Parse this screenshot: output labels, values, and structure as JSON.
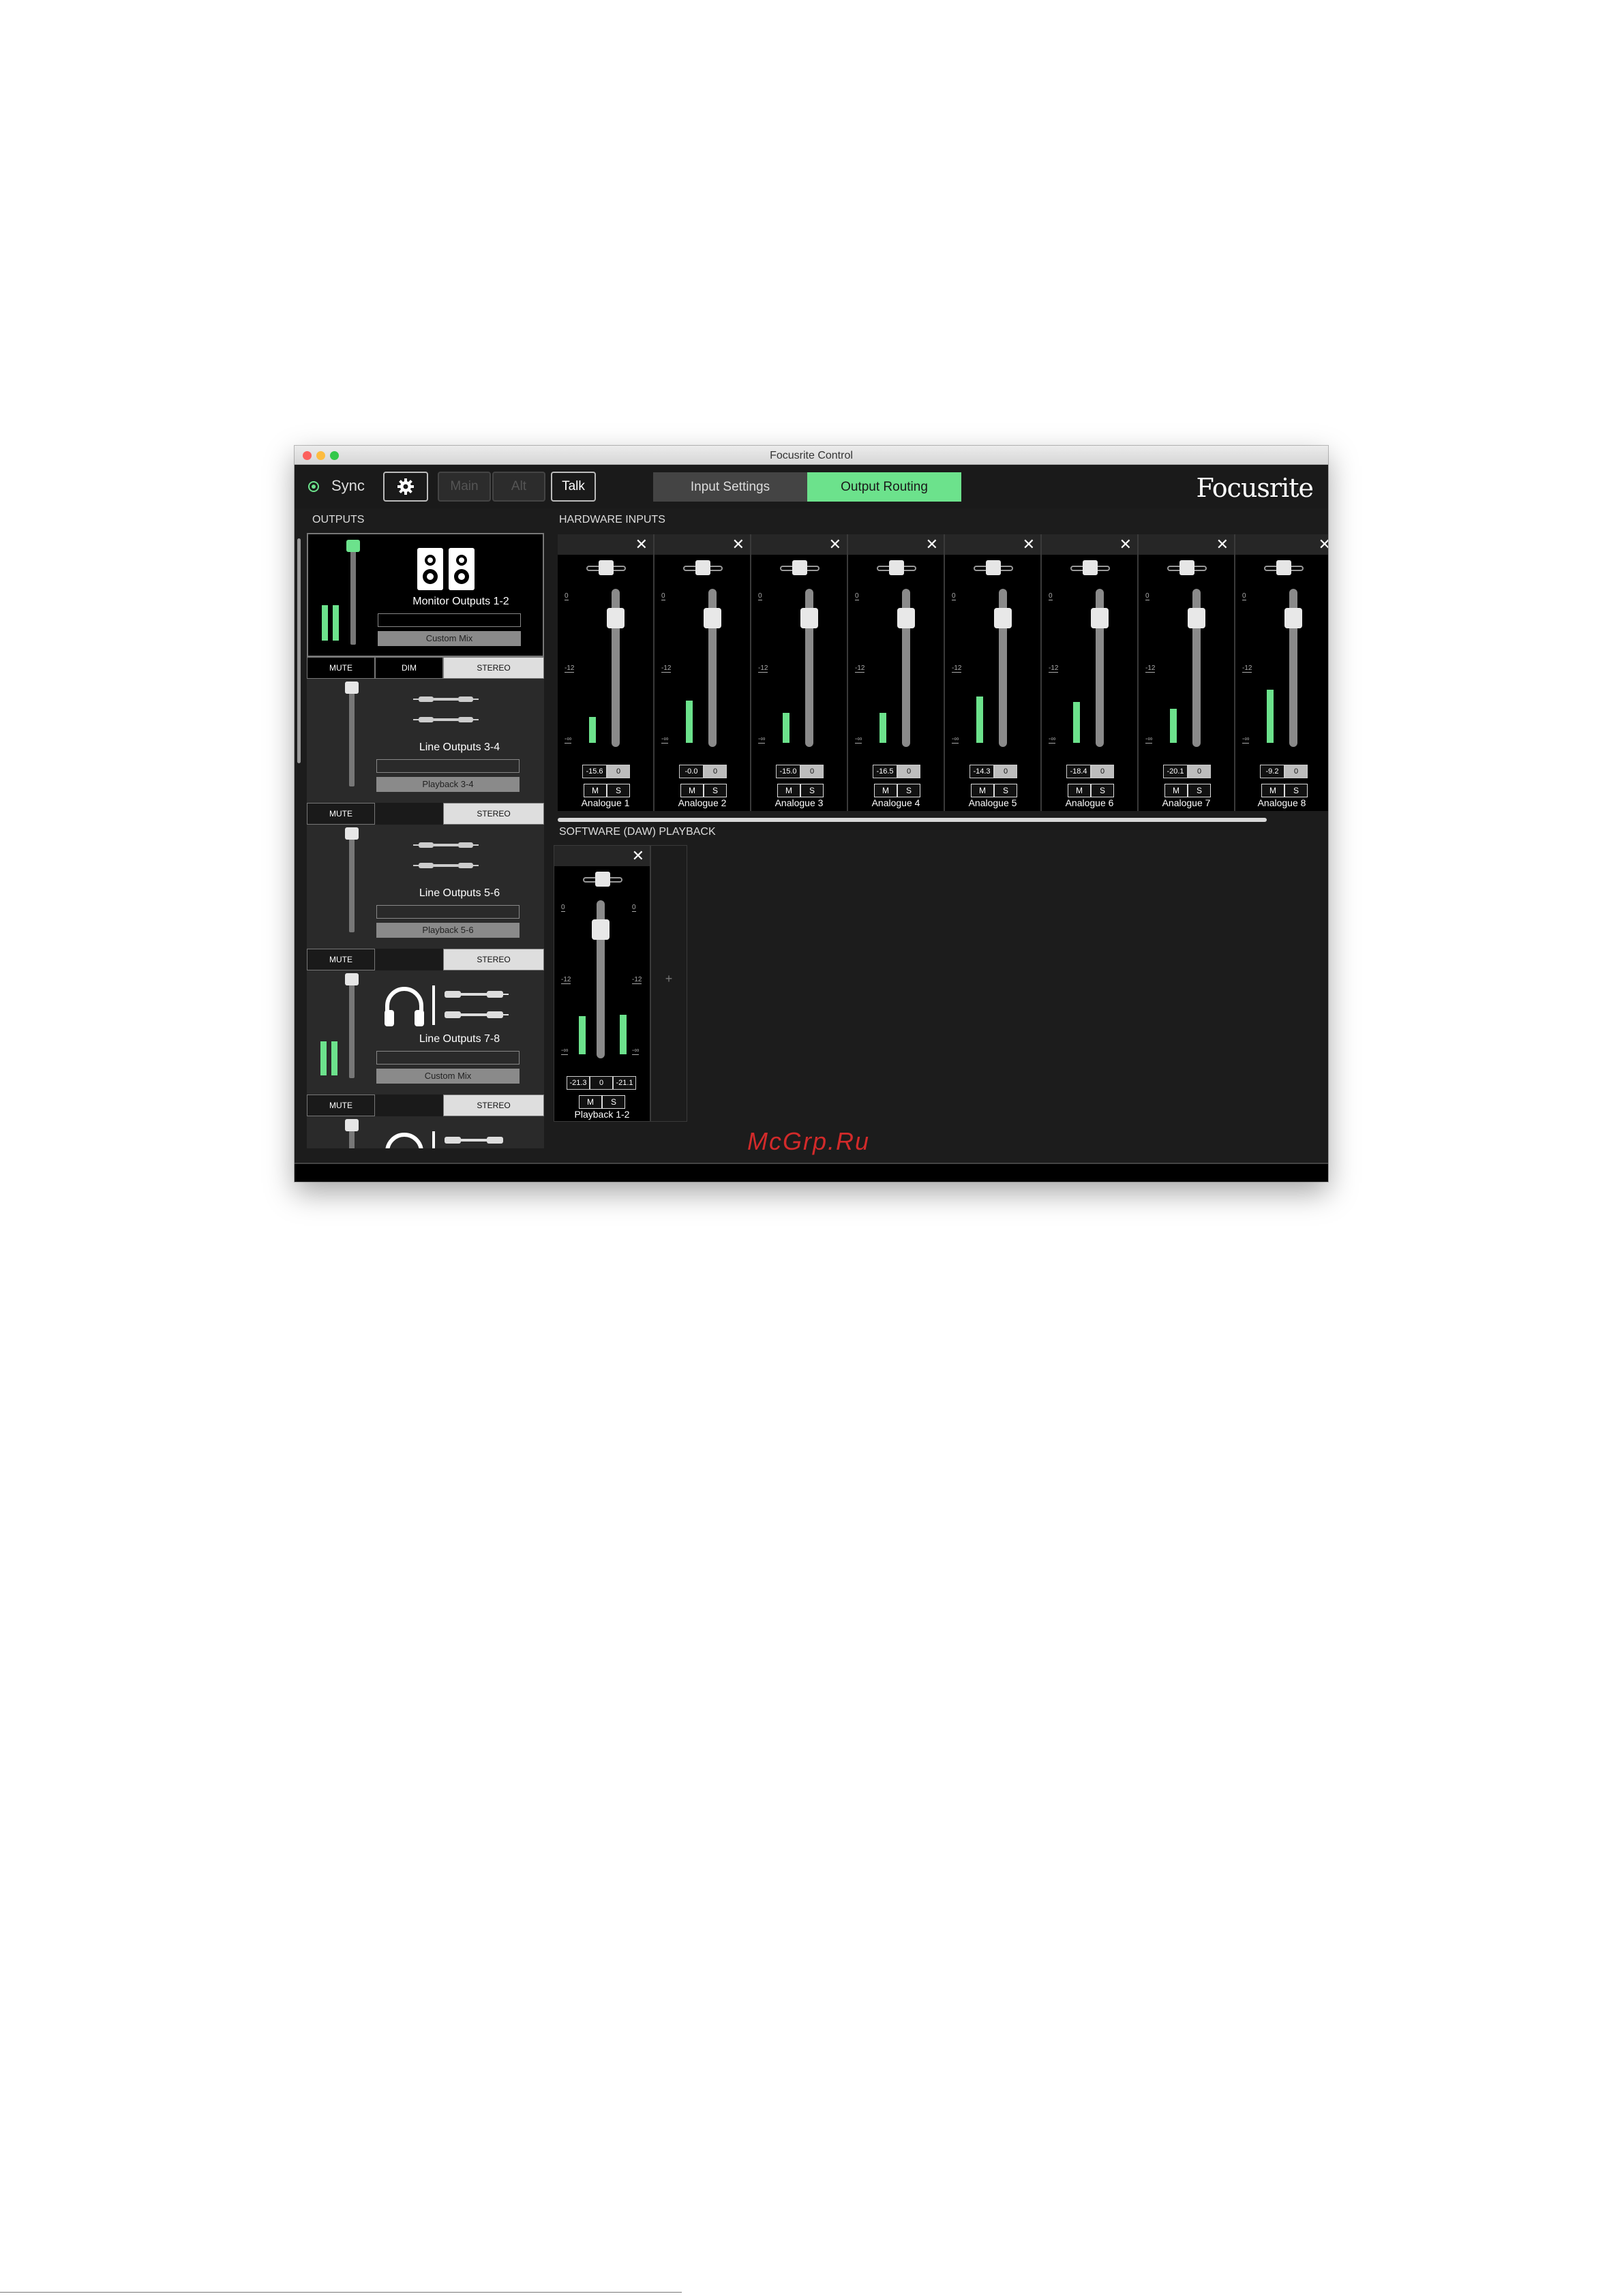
{
  "window": {
    "title": "Focusrite Control"
  },
  "toolbar": {
    "sync_label": "Sync",
    "main_label": "Main",
    "alt_label": "Alt",
    "talk_label": "Talk",
    "tabs": [
      {
        "label": "Input Settings"
      },
      {
        "label": "Output Routing"
      }
    ],
    "brand": "Focusrite"
  },
  "colors": {
    "accent": "#6ce28c",
    "background": "#1c1c1c",
    "watermark": "#d22a2a"
  },
  "outputs": {
    "title": "OUTPUTS",
    "cards": [
      {
        "name": "Monitor Outputs 1-2",
        "source": "Custom Mix",
        "buttons": [
          "MUTE",
          "DIM",
          "STEREO"
        ],
        "icon": "speakers-icon"
      },
      {
        "name": "Line Outputs 3-4",
        "source": "Playback 3-4",
        "buttons": [
          "MUTE",
          "",
          "STEREO"
        ],
        "icon": "jack-cables-icon"
      },
      {
        "name": "Line Outputs 5-6",
        "source": "Playback 5-6",
        "buttons": [
          "MUTE",
          "",
          "STEREO"
        ],
        "icon": "jack-cables-icon"
      },
      {
        "name": "Line Outputs 7-8",
        "source": "Custom Mix",
        "buttons": [
          "MUTE",
          "",
          "STEREO"
        ],
        "icon": "headphones-jack-icon"
      }
    ]
  },
  "hardware_inputs": {
    "title": "HARDWARE INPUTS",
    "scale": [
      "0",
      "-12",
      "-∞"
    ],
    "channels": [
      {
        "name": "Analogue 1",
        "level": "-15.6",
        "pan": "0",
        "mute": "M",
        "solo": "S"
      },
      {
        "name": "Analogue 2",
        "level": "-0.0",
        "pan": "0",
        "mute": "M",
        "solo": "S"
      },
      {
        "name": "Analogue 3",
        "level": "-15.0",
        "pan": "0",
        "mute": "M",
        "solo": "S"
      },
      {
        "name": "Analogue 4",
        "level": "-16.5",
        "pan": "0",
        "mute": "M",
        "solo": "S"
      },
      {
        "name": "Analogue 5",
        "level": "-14.3",
        "pan": "0",
        "mute": "M",
        "solo": "S"
      },
      {
        "name": "Analogue 6",
        "level": "-18.4",
        "pan": "0",
        "mute": "M",
        "solo": "S"
      },
      {
        "name": "Analogue 7",
        "level": "-20.1",
        "pan": "0",
        "mute": "M",
        "solo": "S"
      },
      {
        "name": "Analogue 8",
        "level": "-9.2",
        "pan": "0",
        "mute": "M",
        "solo": "S"
      }
    ]
  },
  "daw_playback": {
    "title": "SOFTWARE (DAW) PLAYBACK",
    "scale": [
      "0",
      "-12",
      "-∞"
    ],
    "channel": {
      "name": "Playback 1-2",
      "level_left": "-21.3",
      "pan": "0",
      "level_right": "-21.1",
      "mute": "M",
      "solo": "S"
    },
    "add_label": "+"
  },
  "watermark": "McGrp.Ru"
}
